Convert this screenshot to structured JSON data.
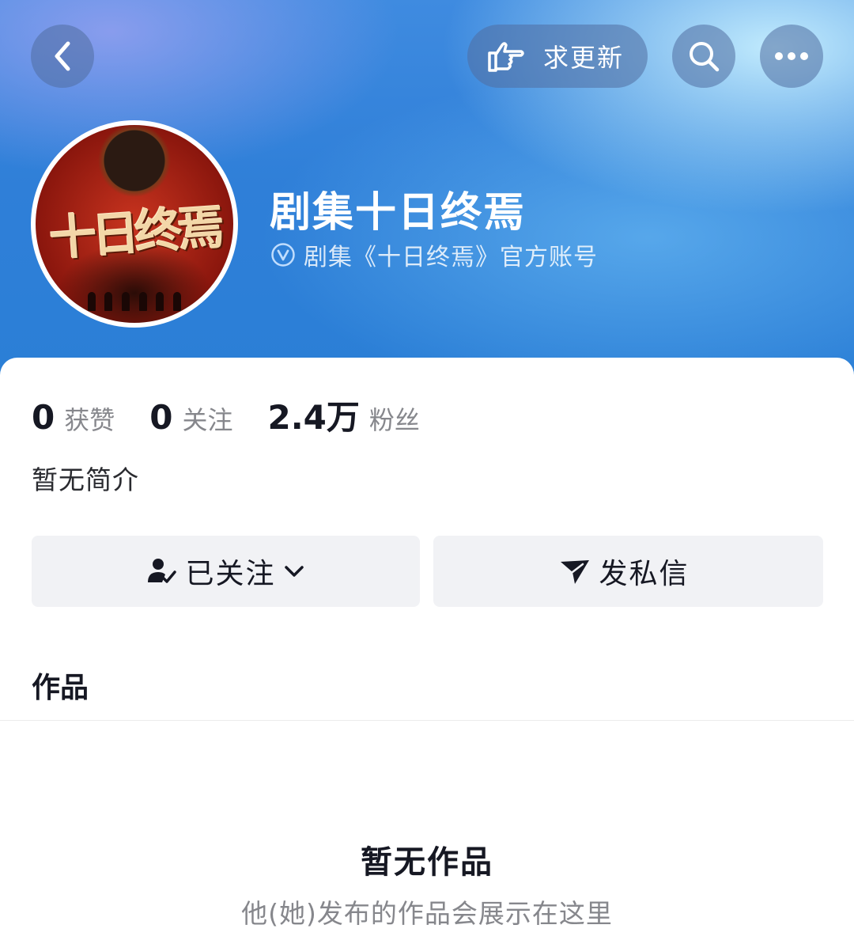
{
  "header": {
    "update_button_label": "求更新",
    "colors": {
      "header_blue": "#2f7fd8",
      "button_bg": "rgba(80,110,160,0.55)"
    }
  },
  "profile": {
    "name": "剧集十日终焉",
    "verified_text": "剧集《十日终焉》官方账号",
    "avatar_title": "十日终焉"
  },
  "stats": [
    {
      "value": "0",
      "label": "获赞"
    },
    {
      "value": "0",
      "label": "关注"
    },
    {
      "value": "2.4万",
      "label": "粉丝"
    }
  ],
  "bio": "暂无简介",
  "actions": {
    "follow_label": "已关注",
    "message_label": "发私信"
  },
  "works": {
    "section_title": "作品",
    "empty_title": "暂无作品",
    "empty_desc": "他(她)发布的作品会展示在这里"
  },
  "icons": [
    "back-icon",
    "pointing-hand-icon",
    "search-icon",
    "more-icon",
    "verified-icon",
    "user-check-icon",
    "chevron-down-icon",
    "send-icon"
  ]
}
